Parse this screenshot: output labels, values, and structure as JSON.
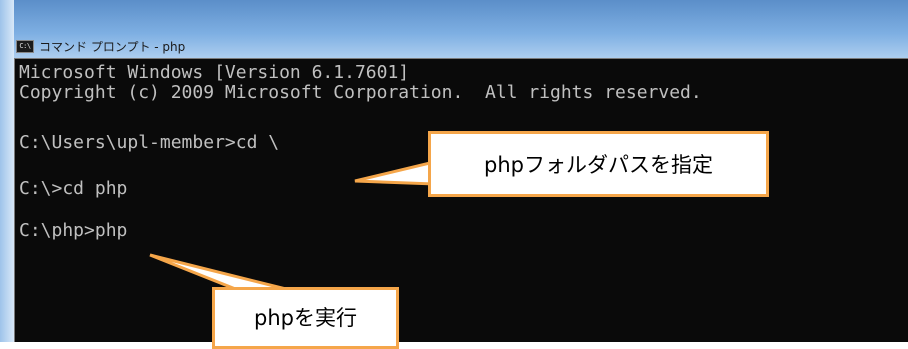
{
  "window": {
    "title": "コマンド プロンプト - php",
    "icon": "cmd-icon",
    "icon_text": "C:\\"
  },
  "console": {
    "lines": [
      "Microsoft Windows [Version 6.1.7601]",
      "Copyright (c) 2009 Microsoft Corporation.  All rights reserved.",
      "",
      "C:\\Users\\upl-member>cd \\",
      "",
      "C:\\>cd php",
      "",
      "C:\\php>php"
    ]
  },
  "annotations": {
    "callout_path": "phpフォルダパスを指定",
    "callout_run": "phpを実行",
    "accent_color": "#f5a64a"
  }
}
